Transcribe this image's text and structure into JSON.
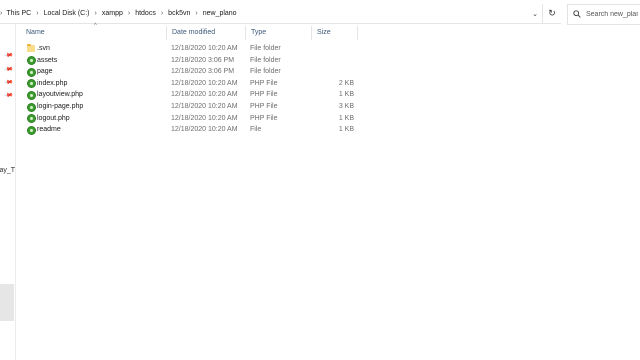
{
  "address_bar": {
    "breadcrumbs": [
      "This PC",
      "Local Disk (C:)",
      "xampp",
      "htdocs",
      "bck5vn",
      "new_plano"
    ]
  },
  "search": {
    "placeholder": "Search new_plano"
  },
  "nav_pane": {
    "clipped_item": "vay_T"
  },
  "columns": {
    "name": "Name",
    "date": "Date modified",
    "type": "Type",
    "size": "Size"
  },
  "files": [
    {
      "name": ".svn",
      "date": "12/18/2020 10:20 AM",
      "type": "File folder",
      "size": "",
      "icon": "svn-folder-icon"
    },
    {
      "name": "assets",
      "date": "12/18/2020 3:06 PM",
      "type": "File folder",
      "size": "",
      "icon": "folder-icon"
    },
    {
      "name": "page",
      "date": "12/18/2020 3:06 PM",
      "type": "File folder",
      "size": "",
      "icon": "folder-icon"
    },
    {
      "name": "index.php",
      "date": "12/18/2020 10:20 AM",
      "type": "PHP File",
      "size": "2 KB",
      "icon": "php-file-icon"
    },
    {
      "name": "layoutview.php",
      "date": "12/18/2020 10:20 AM",
      "type": "PHP File",
      "size": "1 KB",
      "icon": "php-file-icon"
    },
    {
      "name": "login-page.php",
      "date": "12/18/2020 10:20 AM",
      "type": "PHP File",
      "size": "3 KB",
      "icon": "php-file-icon"
    },
    {
      "name": "logout.php",
      "date": "12/18/2020 10:20 AM",
      "type": "PHP File",
      "size": "1 KB",
      "icon": "php-file-icon"
    },
    {
      "name": "readme",
      "date": "12/18/2020 10:20 AM",
      "type": "File",
      "size": "1 KB",
      "icon": "svn-file-icon"
    }
  ]
}
